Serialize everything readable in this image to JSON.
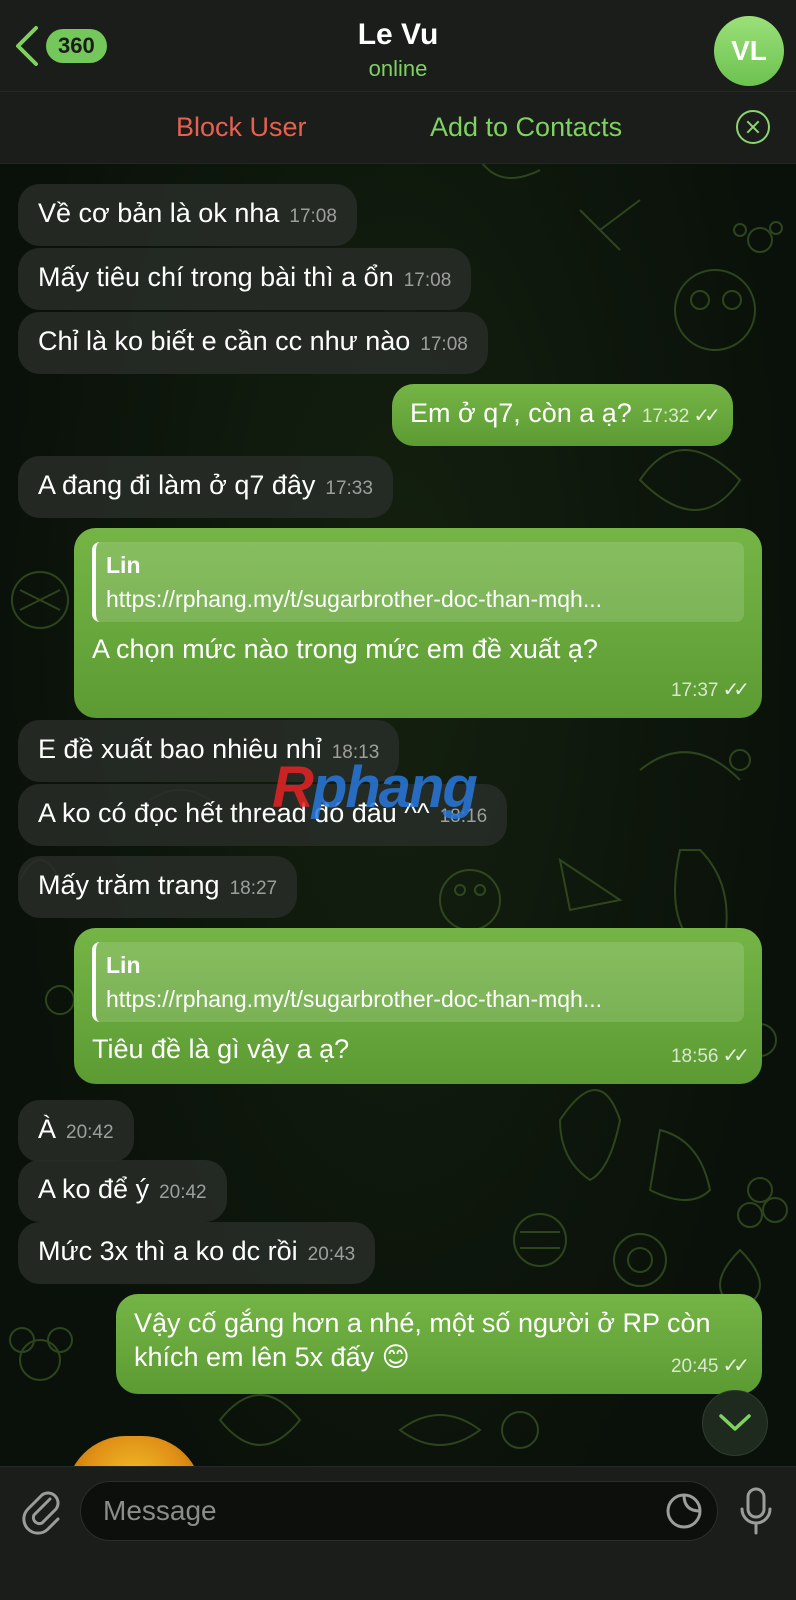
{
  "header": {
    "back_count": "360",
    "title": "Le Vu",
    "status": "online",
    "avatar_initials": "VL"
  },
  "actionbar": {
    "block_label": "Block User",
    "add_label": "Add to Contacts"
  },
  "messages": [
    {
      "dir": "in",
      "text": "Về cơ bản là ok nha",
      "time": "17:08"
    },
    {
      "dir": "in",
      "text": "Mấy tiêu chí trong bài thì a ổn",
      "time": "17:08"
    },
    {
      "dir": "in",
      "text": "Chỉ là ko biết e cần cc như nào",
      "time": "17:08"
    },
    {
      "dir": "out",
      "text": "Em ở q7, còn a ạ?",
      "time": "17:32"
    },
    {
      "dir": "in",
      "text": "A đang đi làm ở q7 đây",
      "time": "17:33"
    },
    {
      "dir": "out",
      "reply_name": "Lin",
      "reply_text": "https://rphang.my/t/sugarbrother-doc-than-mqh...",
      "text": "A chọn mức nào trong mức em đề xuất ạ?",
      "time": "17:37"
    },
    {
      "dir": "in",
      "text": "E đề xuất bao nhiêu nhỉ",
      "time": "18:13"
    },
    {
      "dir": "in",
      "text": "A ko có đọc hết thread đó đâu ^^",
      "time": "18:16"
    },
    {
      "dir": "in",
      "text": "Mấy trăm trang",
      "time": "18:27"
    },
    {
      "dir": "out",
      "reply_name": "Lin",
      "reply_text": "https://rphang.my/t/sugarbrother-doc-than-mqh...",
      "text": "Tiêu đề là gì vậy a ạ?",
      "time": "18:56"
    },
    {
      "dir": "in",
      "text": "À",
      "time": "20:42"
    },
    {
      "dir": "in",
      "text": "A ko để ý",
      "time": "20:42"
    },
    {
      "dir": "in",
      "text": "Mức 3x thì a ko dc rồi",
      "time": "20:43"
    },
    {
      "dir": "out",
      "text": "Vậy cố gắng hơn a nhé, một số người ở RP còn khích em lên 5x đấy 😊",
      "time": "20:45"
    }
  ],
  "watermark": {
    "part1": "R",
    "part2": "phang"
  },
  "input": {
    "placeholder": "Message"
  },
  "colors": {
    "accent_green": "#7fd160",
    "block_red": "#e8604f",
    "bubble_out": "#6aa93d"
  }
}
